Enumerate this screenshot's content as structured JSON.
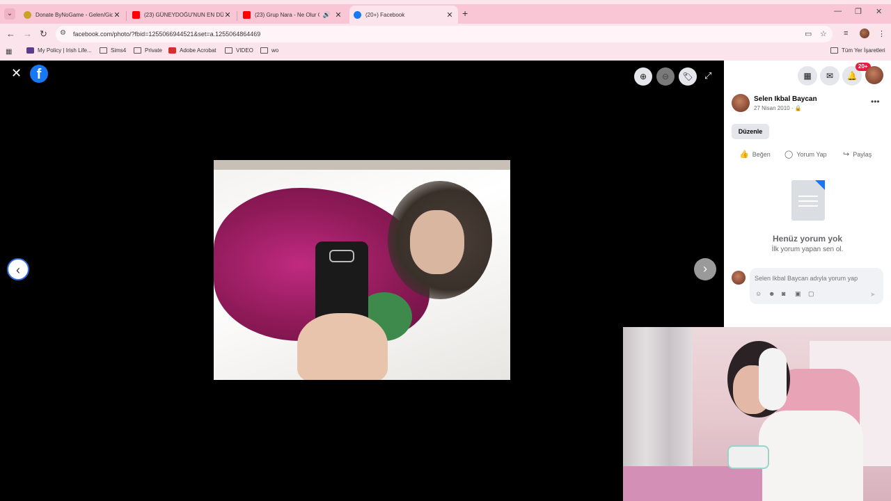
{
  "browser": {
    "tabs": [
      {
        "title": "Donate ByNoGame - Gelen/Gid",
        "icon": "bynogame-icon",
        "color": "#c9a227"
      },
      {
        "title": "(23) GÜNEYDOĞU'NUN EN DÜ",
        "icon": "youtube-icon",
        "color": "#ff0000"
      },
      {
        "title": "(23) Grup Nara - Ne Olur G",
        "icon": "youtube-icon",
        "color": "#ff0000"
      },
      {
        "title": "(20+) Facebook",
        "icon": "facebook-icon",
        "color": "#1877f2"
      }
    ],
    "active_tab_index": 3,
    "url": "facebook.com/photo/?fbid=1255066944521&set=a.1255064864469",
    "bookmarks": [
      {
        "label": "My Policy | Irish Life..."
      },
      {
        "label": "Sims4"
      },
      {
        "label": "Private"
      },
      {
        "label": "Adobe Acrobat"
      },
      {
        "label": "VIDEO"
      },
      {
        "label": "wo"
      }
    ],
    "all_bookmarks_label": "Tüm Yer İşaretleri",
    "accent_color": "#f8c6d5"
  },
  "viewer": {
    "photo_alt": "Mirror selfie with phone in pink jacket"
  },
  "panel": {
    "notification_badge": "20+",
    "post": {
      "author": "Selen Ikbal Baycan",
      "date": "27 Nisan 2010 ·"
    },
    "edit_label": "Düzenle",
    "actions": {
      "like": "Beğen",
      "comment": "Yorum Yap",
      "share": "Paylaş"
    },
    "empty_title": "Henüz yorum yok",
    "empty_subtitle": "İlk yorum yapan sen ol.",
    "comment_placeholder": "Selen Ikbal Baycan adıyla yorum yap"
  }
}
